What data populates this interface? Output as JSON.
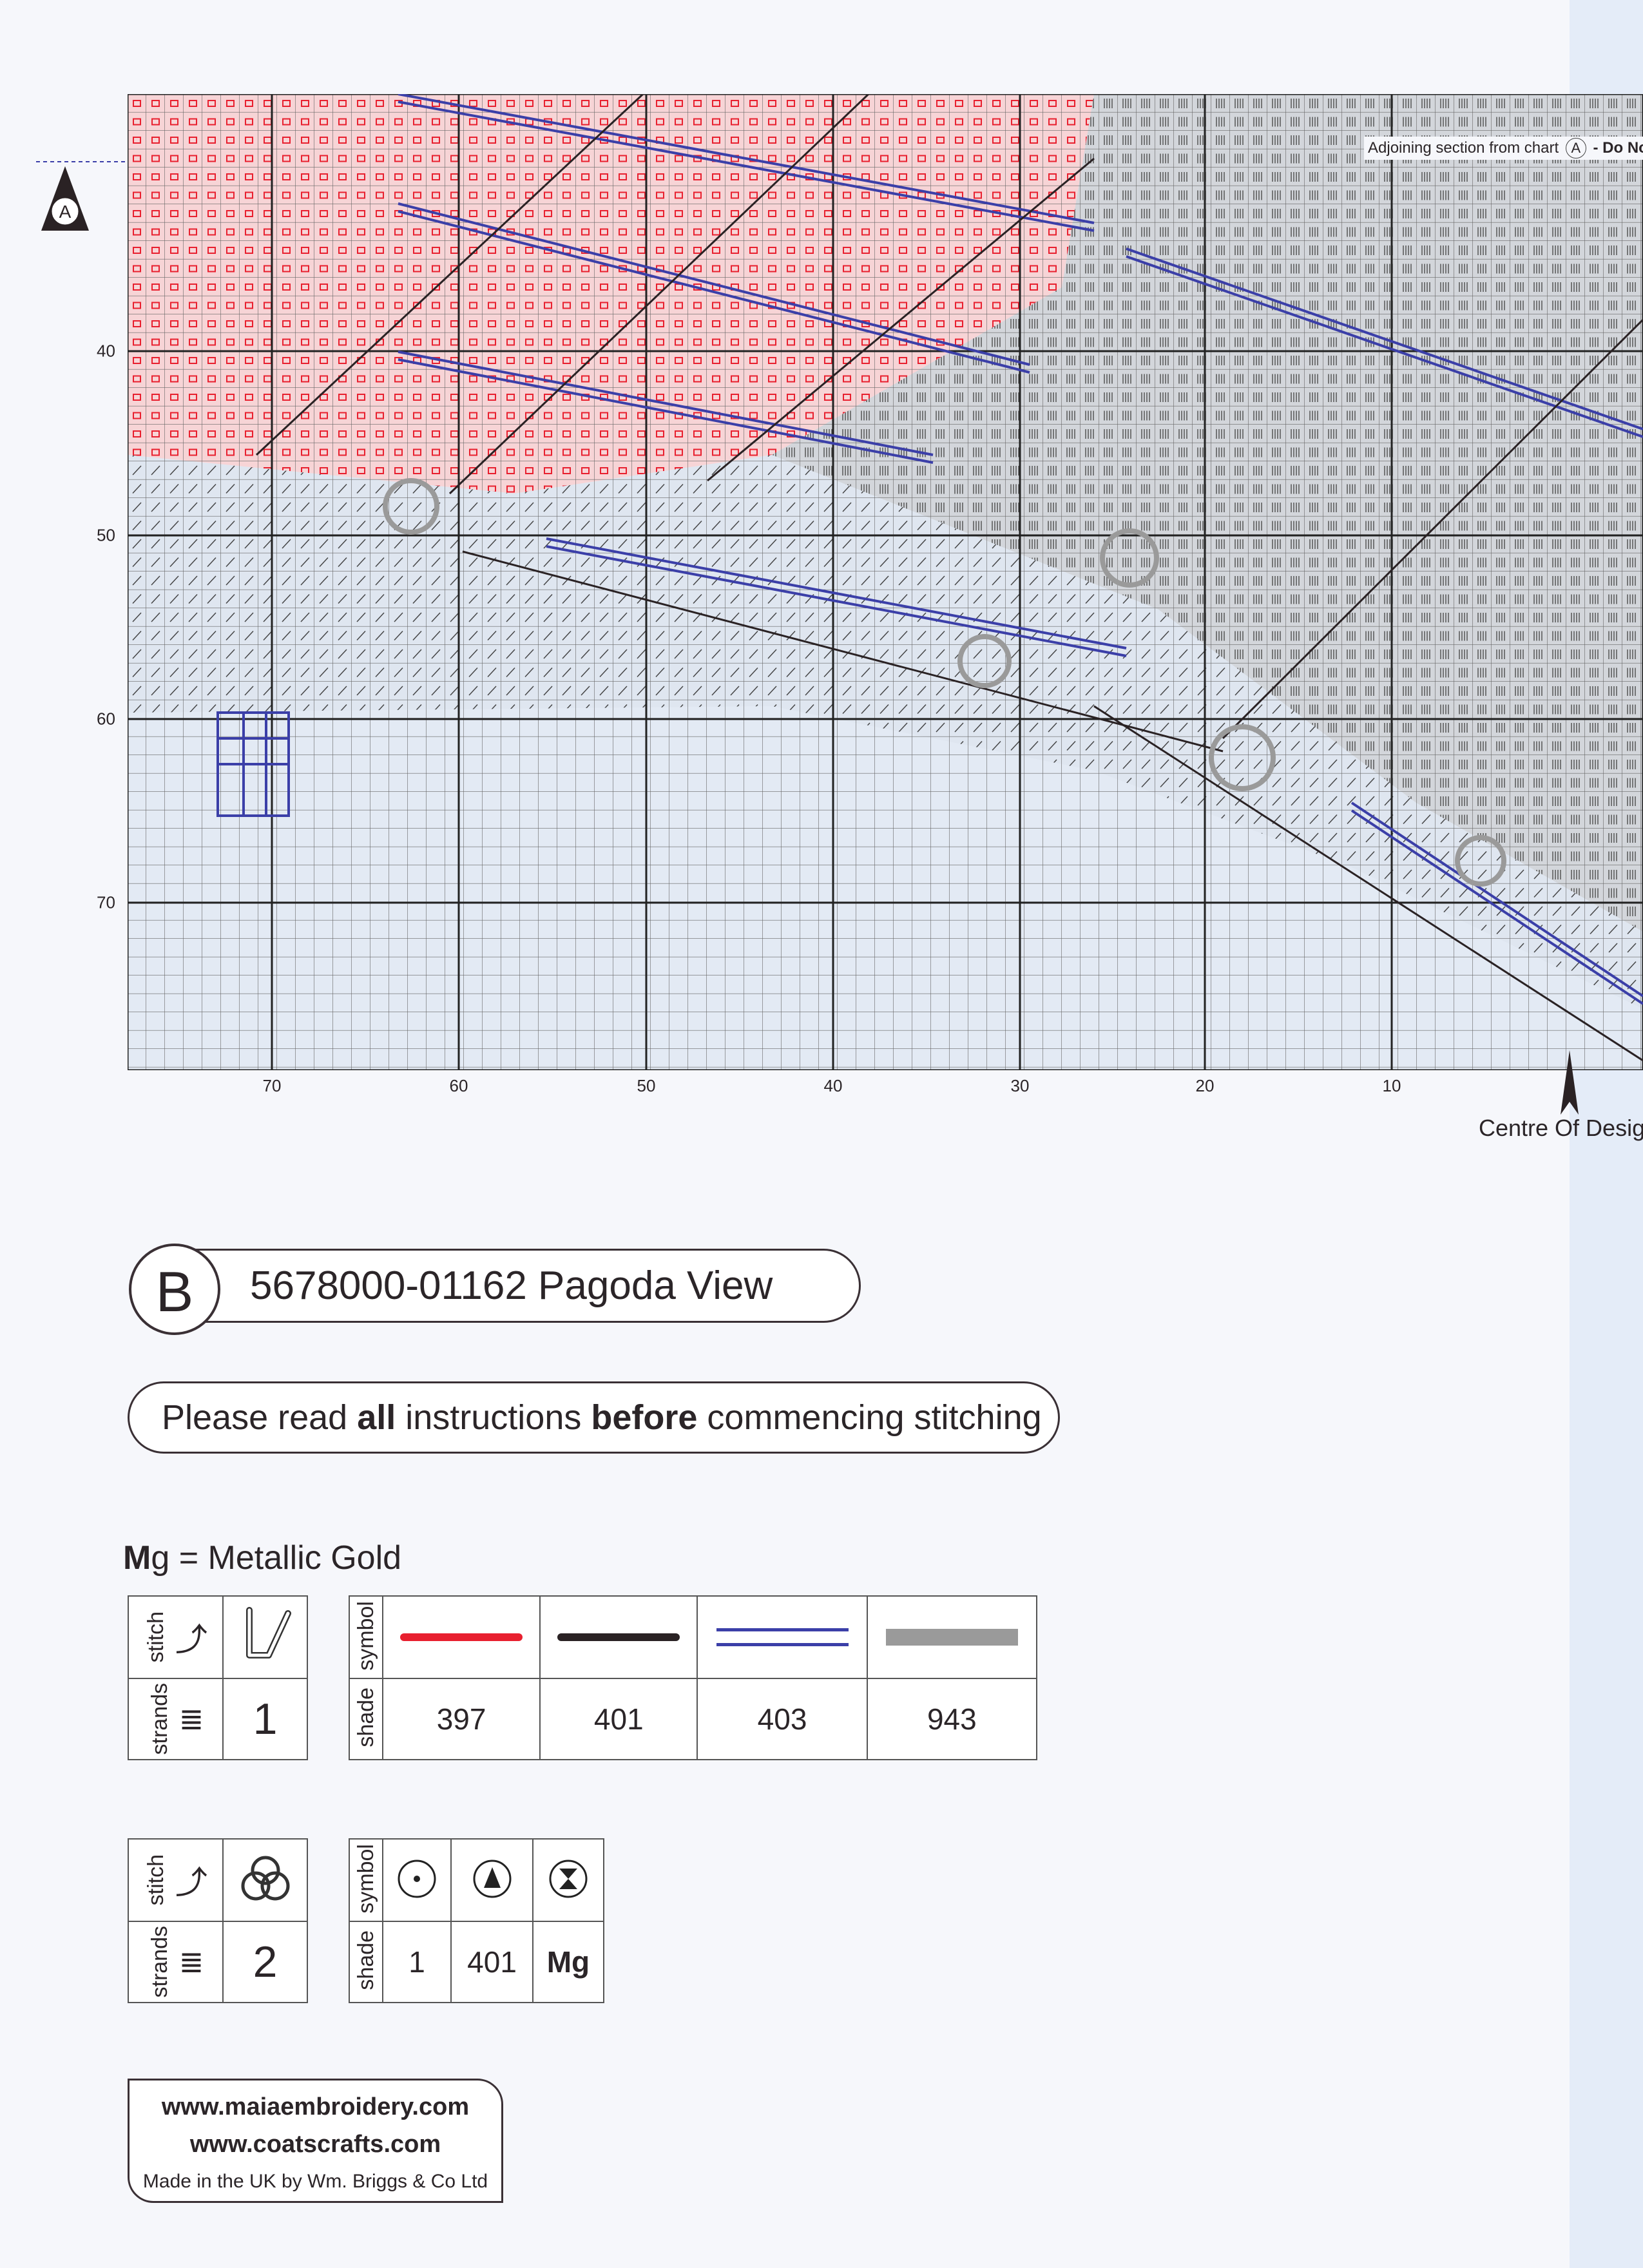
{
  "chart": {
    "row_labels": [
      "40",
      "50",
      "60",
      "70"
    ],
    "col_labels": [
      "70",
      "60",
      "50",
      "40",
      "30",
      "20",
      "10"
    ],
    "adjoining_prefix": "Adjoining section from chart",
    "adjoining_ref": "A",
    "adjoining_suffix": "- Do Not s",
    "section_marker": "A",
    "centre_label": "Centre Of Desig",
    "colors": {
      "pink": "#f4c9cc",
      "grey": "#c9ccd1",
      "blue_light": "#dde6f3",
      "line_black": "#2a2224",
      "line_blue": "#3b3fa8",
      "backstitch_grey": "#9a9a9a",
      "red": "#e8202f"
    }
  },
  "title": {
    "letter": "B",
    "text": "5678000-01162 Pagoda View"
  },
  "instructions": {
    "pre": "Please read ",
    "b1": "all",
    "mid": " instructions ",
    "b2": "before",
    "post": " commencing stitching"
  },
  "legend_note": {
    "bold": "M",
    "rest": "g = Metallic Gold"
  },
  "key1": {
    "stitch_label": "stitch",
    "strands_label": "strands",
    "strands": "1",
    "symbol_label": "symbol",
    "shade_label": "shade",
    "stitch_icon": "backstitch-icon",
    "items": [
      {
        "shade": "397",
        "color": "#e8202f",
        "style": "solid"
      },
      {
        "shade": "401",
        "color": "#2a2224",
        "style": "solid"
      },
      {
        "shade": "403",
        "color": "#3b3fa8",
        "style": "double"
      },
      {
        "shade": "943",
        "color": "#9a9a9a",
        "style": "thick"
      }
    ]
  },
  "key2": {
    "stitch_label": "stitch",
    "strands_label": "strands",
    "strands": "2",
    "symbol_label": "symbol",
    "shade_label": "shade",
    "stitch_icon": "french-knot-icon",
    "items": [
      {
        "shade": "1",
        "symbol": "circle-dot-icon"
      },
      {
        "shade": "401",
        "symbol": "circle-triangle-icon"
      },
      {
        "shade": "Mg",
        "symbol": "circle-hourglass-icon"
      }
    ]
  },
  "footer": {
    "site1": "www.maiaembroidery.com",
    "site2": "www.coatscrafts.com",
    "made": "Made in the UK by Wm. Briggs & Co Ltd"
  }
}
